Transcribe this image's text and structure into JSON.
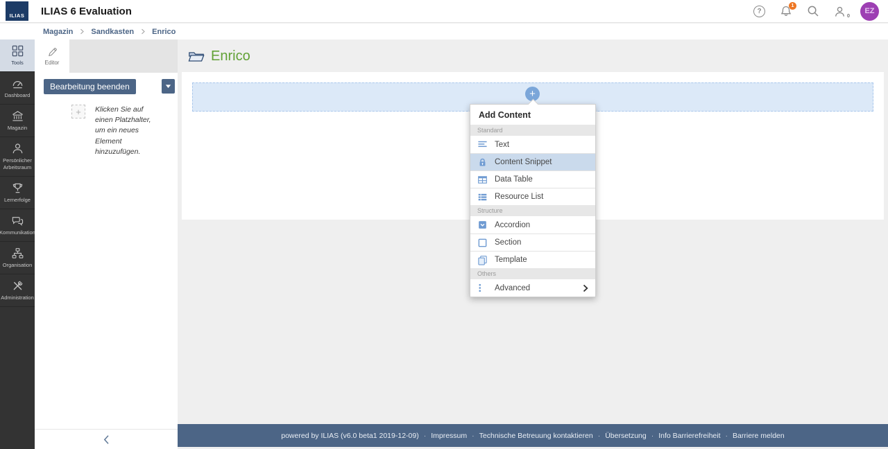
{
  "header": {
    "logo_text": "ILIAS",
    "title": "ILIAS 6 Evaluation",
    "help_glyph": "?",
    "notification_count": "1",
    "awareness_count": "0",
    "avatar_initials": "EZ"
  },
  "breadcrumb": {
    "items": [
      {
        "label": "Magazin"
      },
      {
        "label": "Sandkasten"
      },
      {
        "label": "Enrico"
      }
    ]
  },
  "sidebar": {
    "items": [
      {
        "label": "Tools",
        "icon": "tools-grid-icon",
        "active": true
      },
      {
        "label": "Dashboard",
        "icon": "dashboard-gauge-icon"
      },
      {
        "label": "Magazin",
        "icon": "repository-building-icon"
      },
      {
        "label": "Persönlicher Arbeitsraum",
        "icon": "person-icon"
      },
      {
        "label": "Lernerfolge",
        "icon": "trophy-icon"
      },
      {
        "label": "Kommunikation",
        "icon": "chat-bubbles-icon"
      },
      {
        "label": "Organisation",
        "icon": "org-chart-icon"
      },
      {
        "label": "Administration",
        "icon": "crossed-tools-icon"
      }
    ]
  },
  "panel": {
    "tab_label": "Editor",
    "finish_button_label": "Bearbeitung beenden",
    "caret_icon": "chevron-down-icon",
    "placeholder_glyph": "+",
    "hint_text": "Klicken Sie auf einen Platzhalter, um ein neues Element hinzuzufügen."
  },
  "main": {
    "page_title": "Enrico",
    "title_icon": "folder-icon",
    "add_button_glyph": "+",
    "add_menu": {
      "title": "Add Content",
      "sections": [
        {
          "label": "Standard",
          "items": [
            {
              "label": "Text",
              "icon": "text-icon"
            },
            {
              "label": "Content Snippet",
              "icon": "content-snippet-icon",
              "highlighted": true
            },
            {
              "label": "Data Table",
              "icon": "data-table-icon"
            },
            {
              "label": "Resource List",
              "icon": "resource-list-icon"
            }
          ]
        },
        {
          "label": "Structure",
          "items": [
            {
              "label": "Accordion",
              "icon": "accordion-icon"
            },
            {
              "label": "Section",
              "icon": "section-icon"
            },
            {
              "label": "Template",
              "icon": "template-icon"
            }
          ]
        },
        {
          "label": "Others",
          "items": [
            {
              "label": "Advanced",
              "icon": "advanced-dots-icon",
              "has_submenu": true
            }
          ]
        }
      ]
    }
  },
  "footer": {
    "powered_by": "powered by ILIAS (v6.0 beta1 2019-12-09)",
    "separator": "·",
    "links": [
      {
        "label": "Impressum"
      },
      {
        "label": "Technische Betreuung kontaktieren"
      },
      {
        "label": "Übersetzung"
      },
      {
        "label": "Info Barrierefreiheit"
      },
      {
        "label": "Barriere melden"
      }
    ]
  },
  "colors": {
    "accent": "#4c6586",
    "green": "#61a135",
    "navy": "#1c3b66",
    "sidebar-bg": "#333333",
    "active-item-bg": "#d4dbe5",
    "main-bg": "#efefef",
    "strip-bg": "#e4e4e4",
    "dropzone-bg": "#dce9f8",
    "dropzone-border": "#a9c7ec",
    "add-btn-bg": "#7ba6d9",
    "menu-icon": "#6f9bd2",
    "highlight-row": "#cadaec",
    "badge-orange": "#ee7724",
    "avatar-bg": "#9d3fb3"
  }
}
